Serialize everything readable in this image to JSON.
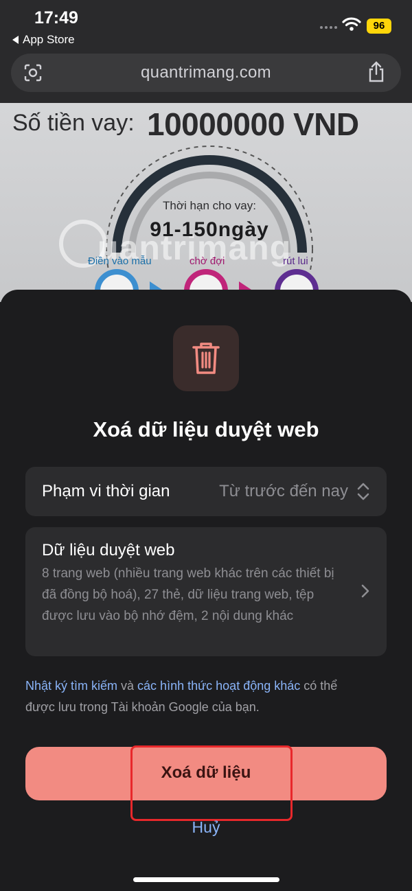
{
  "status_bar": {
    "time": "17:49",
    "back_app": "App Store",
    "battery": "96",
    "battery_color": "#ffd60a"
  },
  "browser": {
    "url": "quantrimang.com",
    "icons": [
      "lens-icon",
      "share-icon"
    ]
  },
  "web_content": {
    "loan_label": "Số tiền vay:",
    "loan_amount": "10000000 VND",
    "term_label": "Thời hạn cho vay:",
    "term_value": "91-150ngày",
    "watermark": "uantrimang",
    "steps": [
      "Điền vào mẫu",
      "chờ đợi",
      "rút lui"
    ]
  },
  "sheet": {
    "title": "Xoá dữ liệu duyệt web",
    "time_range": {
      "label": "Phạm vi thời gian",
      "value": "Từ trước đến nay"
    },
    "browsing_data": {
      "title": "Dữ liệu duyệt web",
      "description": "8 trang web (nhiều trang web khác trên các thiết bị đã đồng bộ hoá), 27 thẻ, dữ liệu trang web, tệp được lưu vào bộ nhớ đệm, 2 nội dung khác"
    },
    "note": {
      "link1": "Nhật ký tìm kiếm",
      "text1": " và ",
      "link2": "các hình thức hoạt động khác",
      "text2": " có thể được lưu trong Tài khoản Google của bạn."
    },
    "delete_button": "Xoá dữ liệu",
    "cancel_button": "Huỷ",
    "accent_color": "#f28b82",
    "link_color": "#8ab4f8"
  }
}
